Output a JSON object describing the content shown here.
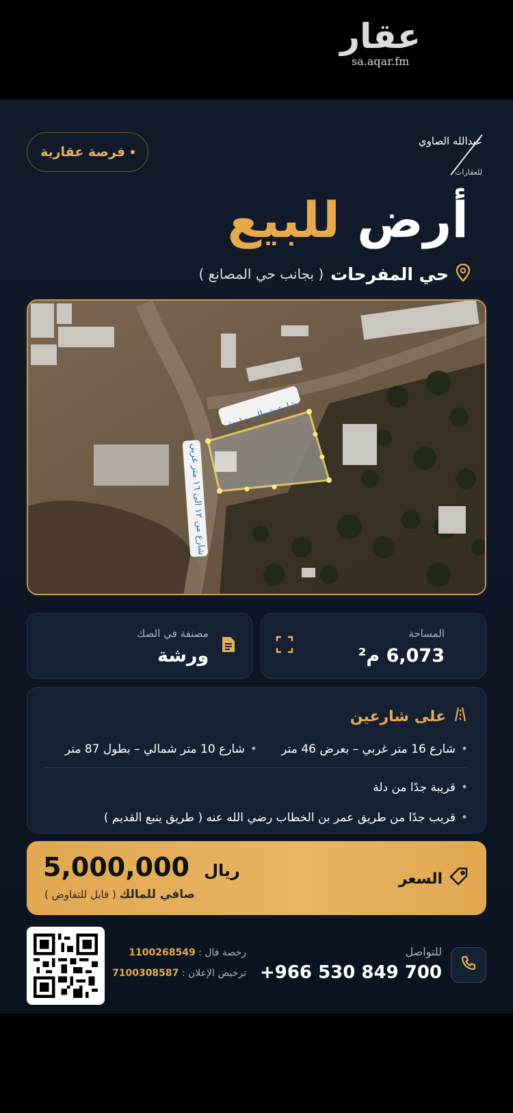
{
  "watermark": {
    "logo_text": "عقار",
    "url": "sa.aqar.fm"
  },
  "brand": {
    "name": "عبدالله الصاوي",
    "subtitle": "للعقارات"
  },
  "badge": {
    "label": "فرصة عقارية"
  },
  "headline": {
    "word1": "أرض",
    "word2": "للبيع"
  },
  "location": {
    "icon": "location-pin-icon",
    "district": "حي المفرحات",
    "note": "( بجانب حي المصانع )"
  },
  "map": {
    "north_street_label": "شارع شمالي ١٠ متر",
    "west_street_label": "شارع من ١٢ الى ١٦ متر غربي"
  },
  "area": {
    "label": "المساحة",
    "value": "6,073 م²",
    "icon": "expand-corners-icon"
  },
  "classification": {
    "label": "مصنفة في الصك",
    "value": "ورشة",
    "icon": "document-icon"
  },
  "streets": {
    "title": "على شارعين",
    "icon": "road-icon",
    "street_west": "شارع 16 متر غربي – بعرض 46 متر",
    "street_north": "شارع 10 متر شمالي – بطول 87 متر",
    "notes": [
      "قريبة جدًا من دلة",
      "قريب جدًا من طريق عمر بن الخطاب رضي الله عنه ( طريق ينبع القديم )"
    ]
  },
  "price": {
    "label": "السعر",
    "icon": "tag-icon",
    "amount": "5,000,000",
    "currency": "ريال",
    "note_bold": "صافي للمالك",
    "note": "( قابل للتفاوض )"
  },
  "license": {
    "fal_key": "رخصة فال :",
    "fal_value": "1100268549",
    "ad_key": "ترخيص الإعلان :",
    "ad_value": "7100308587"
  },
  "contact": {
    "label": "للتواصل",
    "phone": "+966 530 849 700",
    "icon": "phone-icon"
  },
  "colors": {
    "accent": "#e6a94e",
    "background": "#0f1726",
    "card": "#152033"
  }
}
